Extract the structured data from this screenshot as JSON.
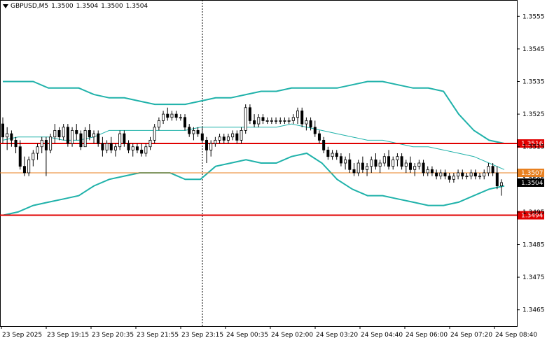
{
  "window": {
    "symbol": "GBPUSD,M5",
    "ohlc": [
      "1.3500",
      "1.3504",
      "1.3500",
      "1.3504"
    ]
  },
  "chart_data": {
    "type": "candlestick",
    "ylim": [
      1.346,
      1.356
    ],
    "y_ticks": [
      "1.3555",
      "1.3545",
      "1.3535",
      "1.3525",
      "1.3515",
      "1.3505",
      "1.3495",
      "1.3485",
      "1.3475",
      "1.3465"
    ],
    "x_ticks": [
      "23 Sep 2025",
      "23 Sep 19:15",
      "23 Sep 20:35",
      "23 Sep 21:55",
      "23 Sep 23:15",
      "24 Sep 00:35",
      "24 Sep 02:00",
      "24 Sep 03:20",
      "24 Sep 04:40",
      "24 Sep 06:00",
      "24 Sep 07:20",
      "24 Sep 08:40"
    ],
    "levels": [
      {
        "value": 1.3516,
        "label": "1.3516",
        "color": "#e00000"
      },
      {
        "value": 1.3507,
        "label": "1.3507",
        "color": "#e88020"
      },
      {
        "value": 1.3504,
        "label": "1.3504",
        "color": "#000000"
      },
      {
        "value": 1.3494,
        "label": "1.3494",
        "color": "#e00000"
      }
    ],
    "period_separator": "23 Sep 23:15",
    "candles": [
      [
        1.3522,
        1.3524,
        1.3516,
        1.3518
      ],
      [
        1.3518,
        1.3521,
        1.3514,
        1.3519
      ],
      [
        1.3519,
        1.352,
        1.3515,
        1.3517
      ],
      [
        1.3517,
        1.3518,
        1.3513,
        1.3515
      ],
      [
        1.3515,
        1.3517,
        1.3508,
        1.3509
      ],
      [
        1.3509,
        1.3512,
        1.3506,
        1.3507
      ],
      [
        1.3507,
        1.3512,
        1.3506,
        1.3511
      ],
      [
        1.3511,
        1.3514,
        1.3509,
        1.3513
      ],
      [
        1.3513,
        1.3516,
        1.3511,
        1.3515
      ],
      [
        1.3515,
        1.3518,
        1.3513,
        1.3517
      ],
      [
        1.3517,
        1.3518,
        1.3506,
        1.3514
      ],
      [
        1.3514,
        1.3519,
        1.3513,
        1.3518
      ],
      [
        1.3518,
        1.3522,
        1.3516,
        1.352
      ],
      [
        1.352,
        1.3521,
        1.3517,
        1.3518
      ],
      [
        1.3518,
        1.3522,
        1.3517,
        1.3521
      ],
      [
        1.3521,
        1.3522,
        1.3515,
        1.3516
      ],
      [
        1.3516,
        1.3521,
        1.3515,
        1.352
      ],
      [
        1.352,
        1.3522,
        1.3517,
        1.3519
      ],
      [
        1.3519,
        1.352,
        1.3514,
        1.3515
      ],
      [
        1.3515,
        1.3521,
        1.3515,
        1.352
      ],
      [
        1.352,
        1.3522,
        1.3517,
        1.3518
      ],
      [
        1.3518,
        1.352,
        1.3516,
        1.3519
      ],
      [
        1.3519,
        1.352,
        1.3515,
        1.3516
      ],
      [
        1.3516,
        1.3518,
        1.3512,
        1.3514
      ],
      [
        1.3514,
        1.3517,
        1.3513,
        1.3516
      ],
      [
        1.3516,
        1.3518,
        1.3513,
        1.3514
      ],
      [
        1.3514,
        1.3516,
        1.3512,
        1.3515
      ],
      [
        1.3515,
        1.352,
        1.3514,
        1.3519
      ],
      [
        1.3519,
        1.352,
        1.3515,
        1.3516
      ],
      [
        1.3516,
        1.3517,
        1.3513,
        1.3514
      ],
      [
        1.3514,
        1.3516,
        1.3512,
        1.3515
      ],
      [
        1.3515,
        1.3516,
        1.3513,
        1.3514
      ],
      [
        1.3514,
        1.3516,
        1.3512,
        1.3513
      ],
      [
        1.3513,
        1.3516,
        1.3512,
        1.3515
      ],
      [
        1.3515,
        1.3518,
        1.3514,
        1.3517
      ],
      [
        1.3517,
        1.3522,
        1.3516,
        1.3521
      ],
      [
        1.3521,
        1.3524,
        1.352,
        1.3523
      ],
      [
        1.3523,
        1.3526,
        1.3522,
        1.3525
      ],
      [
        1.3525,
        1.3527,
        1.3523,
        1.3524
      ],
      [
        1.3524,
        1.3526,
        1.3523,
        1.3525
      ],
      [
        1.3525,
        1.3526,
        1.3523,
        1.3524
      ],
      [
        1.3524,
        1.3525,
        1.3523,
        1.3524
      ],
      [
        1.3524,
        1.3525,
        1.352,
        1.3521
      ],
      [
        1.3521,
        1.3522,
        1.3518,
        1.3519
      ],
      [
        1.3519,
        1.3521,
        1.3517,
        1.352
      ],
      [
        1.352,
        1.3521,
        1.3518,
        1.3519
      ],
      [
        1.3519,
        1.3521,
        1.3516,
        1.3517
      ],
      [
        1.3517,
        1.3518,
        1.351,
        1.3514
      ],
      [
        1.3514,
        1.3517,
        1.3512,
        1.3516
      ],
      [
        1.3516,
        1.3518,
        1.3515,
        1.3517
      ],
      [
        1.3517,
        1.3519,
        1.3516,
        1.3518
      ],
      [
        1.3518,
        1.3519,
        1.3516,
        1.3517
      ],
      [
        1.3517,
        1.3519,
        1.3516,
        1.3518
      ],
      [
        1.3518,
        1.352,
        1.3517,
        1.3519
      ],
      [
        1.3519,
        1.352,
        1.3516,
        1.3517
      ],
      [
        1.3517,
        1.3521,
        1.3516,
        1.352
      ],
      [
        1.352,
        1.3528,
        1.3519,
        1.3527
      ],
      [
        1.3527,
        1.3528,
        1.3522,
        1.3523
      ],
      [
        1.3523,
        1.3525,
        1.3521,
        1.3522
      ],
      [
        1.3522,
        1.3525,
        1.3521,
        1.3524
      ],
      [
        1.3524,
        1.3525,
        1.3522,
        1.3523
      ],
      [
        1.3523,
        1.3524,
        1.3522,
        1.3523
      ],
      [
        1.3523,
        1.3524,
        1.3522,
        1.3523
      ],
      [
        1.3523,
        1.3524,
        1.3522,
        1.3523
      ],
      [
        1.3523,
        1.3524,
        1.3522,
        1.3523
      ],
      [
        1.3523,
        1.3524,
        1.3522,
        1.3523
      ],
      [
        1.3523,
        1.3524,
        1.3522,
        1.3523
      ],
      [
        1.3523,
        1.3525,
        1.3522,
        1.3524
      ],
      [
        1.3524,
        1.3527,
        1.3522,
        1.3526
      ],
      [
        1.3526,
        1.3527,
        1.3521,
        1.3522
      ],
      [
        1.3522,
        1.3524,
        1.352,
        1.3523
      ],
      [
        1.3523,
        1.3524,
        1.352,
        1.3521
      ],
      [
        1.3521,
        1.3523,
        1.3518,
        1.3519
      ],
      [
        1.3519,
        1.352,
        1.3516,
        1.3517
      ],
      [
        1.3517,
        1.3518,
        1.3513,
        1.3514
      ],
      [
        1.3514,
        1.3515,
        1.3511,
        1.3512
      ],
      [
        1.3512,
        1.3514,
        1.3511,
        1.3513
      ],
      [
        1.3513,
        1.3514,
        1.3511,
        1.3512
      ],
      [
        1.3512,
        1.3513,
        1.3509,
        1.351
      ],
      [
        1.351,
        1.3512,
        1.3508,
        1.3511
      ],
      [
        1.3511,
        1.3513,
        1.3507,
        1.3508
      ],
      [
        1.3508,
        1.351,
        1.3506,
        1.3507
      ],
      [
        1.3507,
        1.3511,
        1.3506,
        1.351
      ],
      [
        1.351,
        1.3512,
        1.3507,
        1.3508
      ],
      [
        1.3508,
        1.351,
        1.3506,
        1.3509
      ],
      [
        1.3509,
        1.3512,
        1.3507,
        1.3511
      ],
      [
        1.3511,
        1.3513,
        1.3508,
        1.3509
      ],
      [
        1.3509,
        1.3511,
        1.3507,
        1.351
      ],
      [
        1.351,
        1.3513,
        1.3509,
        1.3512
      ],
      [
        1.3512,
        1.3514,
        1.3508,
        1.3509
      ],
      [
        1.3509,
        1.3512,
        1.3508,
        1.3511
      ],
      [
        1.3511,
        1.3513,
        1.3509,
        1.3512
      ],
      [
        1.3512,
        1.3513,
        1.3508,
        1.3509
      ],
      [
        1.3509,
        1.3511,
        1.3507,
        1.351
      ],
      [
        1.351,
        1.3512,
        1.3507,
        1.3508
      ],
      [
        1.3508,
        1.351,
        1.3506,
        1.3509
      ],
      [
        1.3509,
        1.3511,
        1.3508,
        1.351
      ],
      [
        1.351,
        1.3511,
        1.3506,
        1.3507
      ],
      [
        1.3507,
        1.3509,
        1.3506,
        1.3508
      ],
      [
        1.3508,
        1.3509,
        1.3506,
        1.3507
      ],
      [
        1.3507,
        1.3508,
        1.3505,
        1.3506
      ],
      [
        1.3506,
        1.3508,
        1.3505,
        1.3507
      ],
      [
        1.3507,
        1.3508,
        1.3505,
        1.3506
      ],
      [
        1.3506,
        1.3507,
        1.3504,
        1.3505
      ],
      [
        1.3505,
        1.3507,
        1.3504,
        1.3506
      ],
      [
        1.3506,
        1.3508,
        1.3505,
        1.3507
      ],
      [
        1.3507,
        1.3508,
        1.3505,
        1.3506
      ],
      [
        1.3506,
        1.3507,
        1.3505,
        1.3506
      ],
      [
        1.3506,
        1.3508,
        1.3505,
        1.3507
      ],
      [
        1.3507,
        1.3508,
        1.3505,
        1.3506
      ],
      [
        1.3506,
        1.3507,
        1.3505,
        1.3506
      ],
      [
        1.3506,
        1.3508,
        1.3505,
        1.3507
      ],
      [
        1.3507,
        1.351,
        1.3506,
        1.3509
      ],
      [
        1.3509,
        1.351,
        1.3506,
        1.3507
      ],
      [
        1.3507,
        1.3509,
        1.3502,
        1.3503
      ],
      [
        1.3503,
        1.3505,
        1.35,
        1.3504
      ]
    ],
    "bollinger": {
      "upper": [
        1.3535,
        1.3535,
        1.3535,
        1.3533,
        1.3533,
        1.3533,
        1.3531,
        1.353,
        1.353,
        1.3529,
        1.3528,
        1.3528,
        1.3528,
        1.3529,
        1.353,
        1.353,
        1.3531,
        1.3532,
        1.3532,
        1.3533,
        1.3533,
        1.3533,
        1.3533,
        1.3534,
        1.3535,
        1.3535,
        1.3534,
        1.3533,
        1.3533,
        1.3532,
        1.3525,
        1.352,
        1.3517,
        1.3516
      ],
      "middle": [
        1.3517,
        1.3518,
        1.3518,
        1.3518,
        1.3517,
        1.3517,
        1.3518,
        1.352,
        1.352,
        1.352,
        1.352,
        1.352,
        1.352,
        1.3521,
        1.3521,
        1.3521,
        1.3521,
        1.3521,
        1.3521,
        1.3522,
        1.3521,
        1.352,
        1.3519,
        1.3518,
        1.3517,
        1.3517,
        1.3516,
        1.3515,
        1.3515,
        1.3514,
        1.3513,
        1.3512,
        1.351,
        1.3508
      ],
      "lower": [
        1.3494,
        1.3495,
        1.3497,
        1.3498,
        1.3499,
        1.35,
        1.3503,
        1.3505,
        1.3506,
        1.3507,
        1.3507,
        1.3507,
        1.3505,
        1.3505,
        1.3509,
        1.351,
        1.3511,
        1.351,
        1.351,
        1.3512,
        1.3513,
        1.351,
        1.3505,
        1.3502,
        1.35,
        1.35,
        1.3499,
        1.3498,
        1.3497,
        1.3497,
        1.3498,
        1.35,
        1.3502,
        1.3503
      ]
    },
    "colors": {
      "candle": "#000000",
      "band": "#20b2aa",
      "grid": "#c8c8c8"
    }
  }
}
